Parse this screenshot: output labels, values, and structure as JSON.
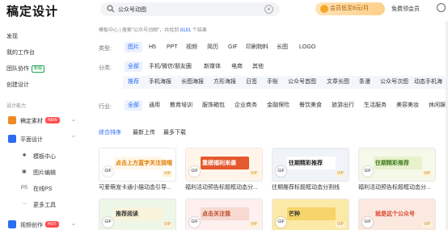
{
  "app": {
    "logo": "稿定设计"
  },
  "search": {
    "value": "公众号动图"
  },
  "header": {
    "vip_banner": "会员低至8元/月",
    "free_vip": "免费领会员"
  },
  "sidebar": {
    "top_items": [
      "发现",
      "我的工作台",
      "团队协作",
      "创建设计"
    ],
    "team_tag": "新版",
    "section_label": "设计能力",
    "material": {
      "label": "稿定素材",
      "badge": "NEW"
    },
    "design": {
      "label": "平面设计"
    },
    "sub_items": [
      {
        "icon": "✺",
        "label": "模板中心"
      },
      {
        "icon": "▣",
        "label": "图片编辑"
      },
      {
        "icon": "PS",
        "label": "在线PS"
      },
      {
        "icon": "⋯",
        "label": "更多工具"
      }
    ],
    "video": {
      "label": "视频创作",
      "badge": "HOT"
    }
  },
  "breadcrumb": {
    "prefix": "模板中心 | 搜索\"公众号动图\"，共找到 ",
    "count": "8181",
    "suffix": " 个结果"
  },
  "filters": {
    "type_label": "类型:",
    "types": [
      "图片",
      "H5",
      "PPT",
      "视频",
      "简历",
      "GIF",
      "印刷物料",
      "长图",
      "LOGO"
    ],
    "category_label": "分类:",
    "categories": [
      "全部",
      "手机/微信/朋友圈",
      "新媒体",
      "电商",
      "其他"
    ],
    "subcategories": [
      "推荐",
      "手机海报",
      "长图海报",
      "方形海报",
      "日签",
      "手账",
      "公众号首图",
      "文章长图",
      "条漫",
      "公众号次图",
      "动态手机海"
    ],
    "industry_label": "行业:",
    "industries": [
      "全部",
      "通用",
      "教育培训",
      "服饰箱包",
      "企业商务",
      "金融保险",
      "餐饮美食",
      "旅游出行",
      "生活服务",
      "美容美妆",
      "休闲娱"
    ]
  },
  "sort": [
    "综合排序",
    "最新上传",
    "最多下载"
  ],
  "cards_row1": [
    {
      "text": "点击上方蓝字关注我哦",
      "title": "可爱萌宠卡通小猫动态引导...",
      "bg": "#ffffff",
      "inner": "#fff7e8",
      "color": "#e07a00"
    },
    {
      "text": "重磅福利来袭",
      "title": "福利活动预告标题框动态分...",
      "bg": "#fff5ea",
      "inner": "#e4592d",
      "color": "#ffffff"
    },
    {
      "text": "往期精彩推荐",
      "title": "往期推荐标题框动态分割线",
      "bg": "#f0f3f8",
      "inner": "#ffffff",
      "color": "#222222"
    },
    {
      "text": "往期精彩推荐",
      "title": "福利活动预告标题框动态分...",
      "bg": "#f4f9ea",
      "inner": "#e7f2cd",
      "color": "#3d7a1a"
    }
  ],
  "cards_row2": [
    {
      "text": "推荐阅读",
      "bg": "#eef6e8",
      "inner": "#f9f3da",
      "color": "#333333"
    },
    {
      "text": "点击关注我",
      "bg": "#fdf0ef",
      "inner": "#f7d9d2",
      "color": "#b8451f"
    },
    {
      "text": "芒种",
      "bg": "#fbe9a8",
      "inner": "#f6d46a",
      "color": "#333333"
    },
    {
      "text": "就是这个公众号",
      "bg": "#fbe8df",
      "inner": "#fbe8df",
      "color": "#d9452b"
    }
  ],
  "gif_label": "GIF",
  "vip_label": "VIP"
}
